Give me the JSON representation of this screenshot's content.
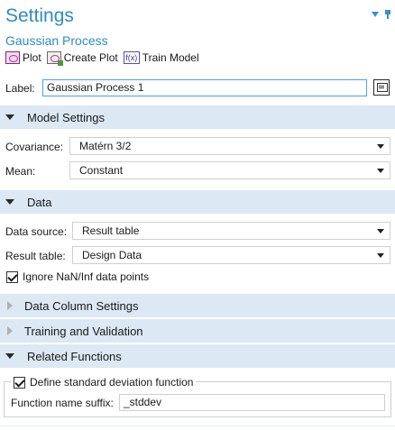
{
  "header": {
    "title": "Settings",
    "subtitle": "Gaussian Process"
  },
  "toolbar": {
    "plot_label": "Plot",
    "create_plot_label": "Create Plot",
    "train_model_label": "Train Model",
    "fx_glyph": "f(x)"
  },
  "label_field": {
    "label": "Label:",
    "value": "Gaussian Process 1"
  },
  "sections": {
    "model_settings": "Model Settings",
    "data": "Data",
    "data_column_settings": "Data Column Settings",
    "training_validation": "Training and Validation",
    "related_functions": "Related Functions"
  },
  "model_settings": {
    "covariance_label": "Covariance:",
    "covariance_value": "Matérn 3/2",
    "mean_label": "Mean:",
    "mean_value": "Constant"
  },
  "data": {
    "source_label": "Data source:",
    "source_value": "Result table",
    "table_label": "Result table:",
    "table_value": "Design Data",
    "ignore_nan_label": "Ignore NaN/Inf data points",
    "ignore_nan_checked": true
  },
  "related_functions": {
    "define_std_label": "Define standard deviation function",
    "define_std_checked": true,
    "suffix_label": "Function name suffix:",
    "suffix_value": "_stddev"
  },
  "colors": {
    "accent": "#2e8bc4",
    "section_bg": "#dce8f4"
  }
}
